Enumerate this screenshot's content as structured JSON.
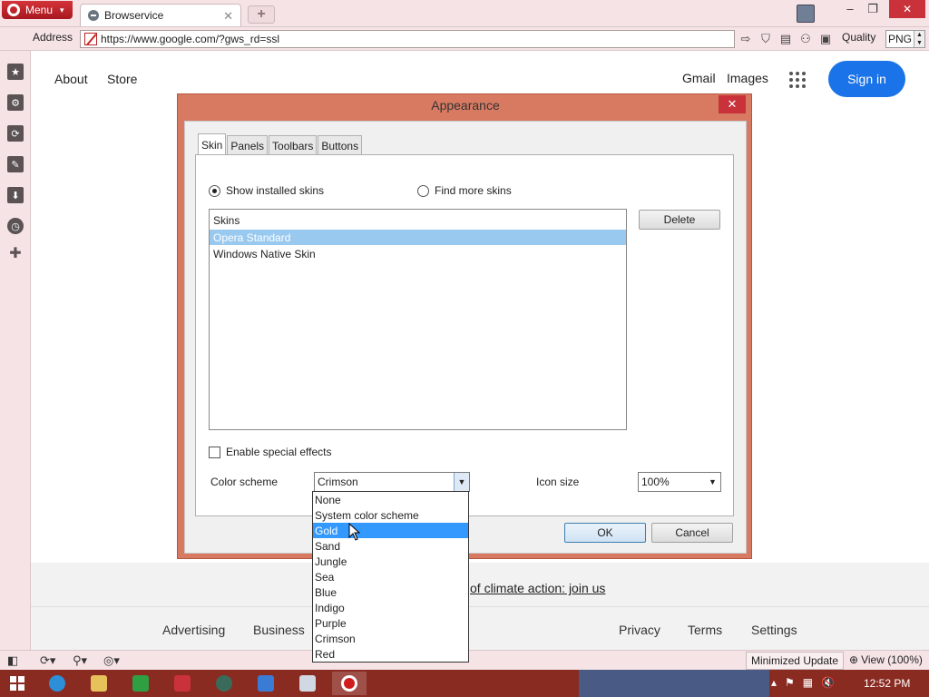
{
  "browser": {
    "menu_label": "Menu",
    "tab_title": "Browservice",
    "address_label": "Address",
    "url": "https://www.google.com/?gws_rd=ssl",
    "quality_label": "Quality",
    "quality_value": "PNG"
  },
  "google": {
    "about": "About",
    "store": "Store",
    "gmail": "Gmail",
    "images": "Images",
    "sign_in": "Sign in",
    "climate_text": "of climate action: join us",
    "footer": {
      "advertising": "Advertising",
      "business": "Business",
      "privacy": "Privacy",
      "terms": "Terms",
      "settings": "Settings"
    }
  },
  "dialog": {
    "title": "Appearance",
    "close_glyph": "✕",
    "tabs": [
      "Skin",
      "Panels",
      "Toolbars",
      "Buttons"
    ],
    "active_tab": "Skin",
    "radio_installed": "Show installed skins",
    "radio_find": "Find more skins",
    "skins_header": "Skins",
    "skins": [
      "Opera Standard",
      "Windows Native Skin"
    ],
    "selected_skin": "Opera Standard",
    "delete_label": "Delete",
    "special_effects_label": "Enable special effects",
    "color_scheme_label": "Color scheme",
    "color_scheme_value": "Crimson",
    "icon_size_label": "Icon size",
    "icon_size_value": "100%",
    "ok_label": "OK",
    "cancel_label": "Cancel",
    "color_options": [
      "None",
      "System color scheme",
      "Gold",
      "Sand",
      "Jungle",
      "Sea",
      "Blue",
      "Indigo",
      "Purple",
      "Crimson",
      "Red"
    ],
    "highlighted_option": "Gold"
  },
  "status": {
    "minimized_update": "Minimized Update",
    "view_zoom": "View (100%)"
  },
  "taskbar": {
    "clock": "12:52 PM"
  },
  "colors": {
    "opera_red": "#c9323a",
    "dialog_frame": "#d87a62",
    "google_blue": "#1a73e8",
    "highlight": "#3399ff",
    "taskbar": "#8a2b22"
  }
}
